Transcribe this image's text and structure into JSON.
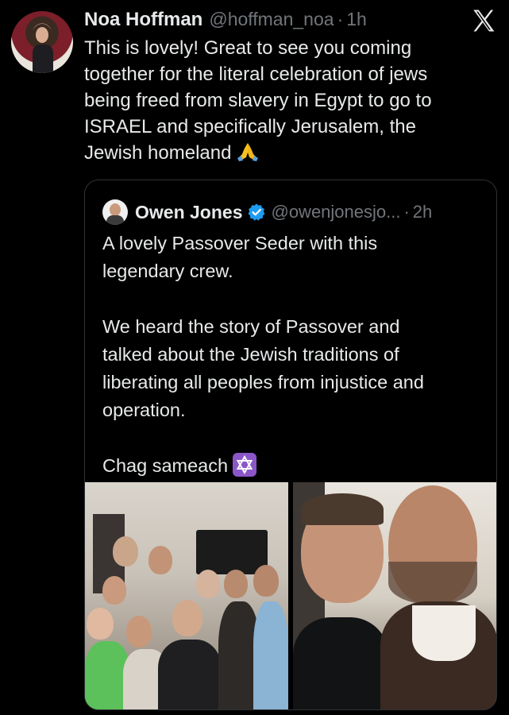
{
  "tweet": {
    "author_name": "Noa Hoffman",
    "author_handle": "@hoffman_noa",
    "separator": "·",
    "time": "1h",
    "lines": [
      "This is lovely! Great to see you coming",
      "together for the literal celebration of jews",
      "being freed from slavery in Egypt to go to",
      "ISRAEL and specifically Jerusalem, the",
      "Jewish homeland"
    ],
    "emoji": "folded-hands-emoji"
  },
  "quoted": {
    "author_name": "Owen Jones",
    "author_handle": "@owenjonesjo...",
    "separator": "·",
    "time": "2h",
    "paragraph1": [
      "A lovely Passover Seder with this",
      "legendary crew."
    ],
    "paragraph2": [
      "We heard the story of Passover and",
      "talked about the Jewish traditions of",
      "liberating all peoples from injustice and",
      "operation."
    ],
    "paragraph3": "Chag sameach",
    "emoji": "star-of-david-emoji"
  },
  "colors": {
    "background": "#000000",
    "text": "#e7e9ea",
    "secondary": "#71767b",
    "verified": "#1d9bf0",
    "border": "#2f3336"
  }
}
